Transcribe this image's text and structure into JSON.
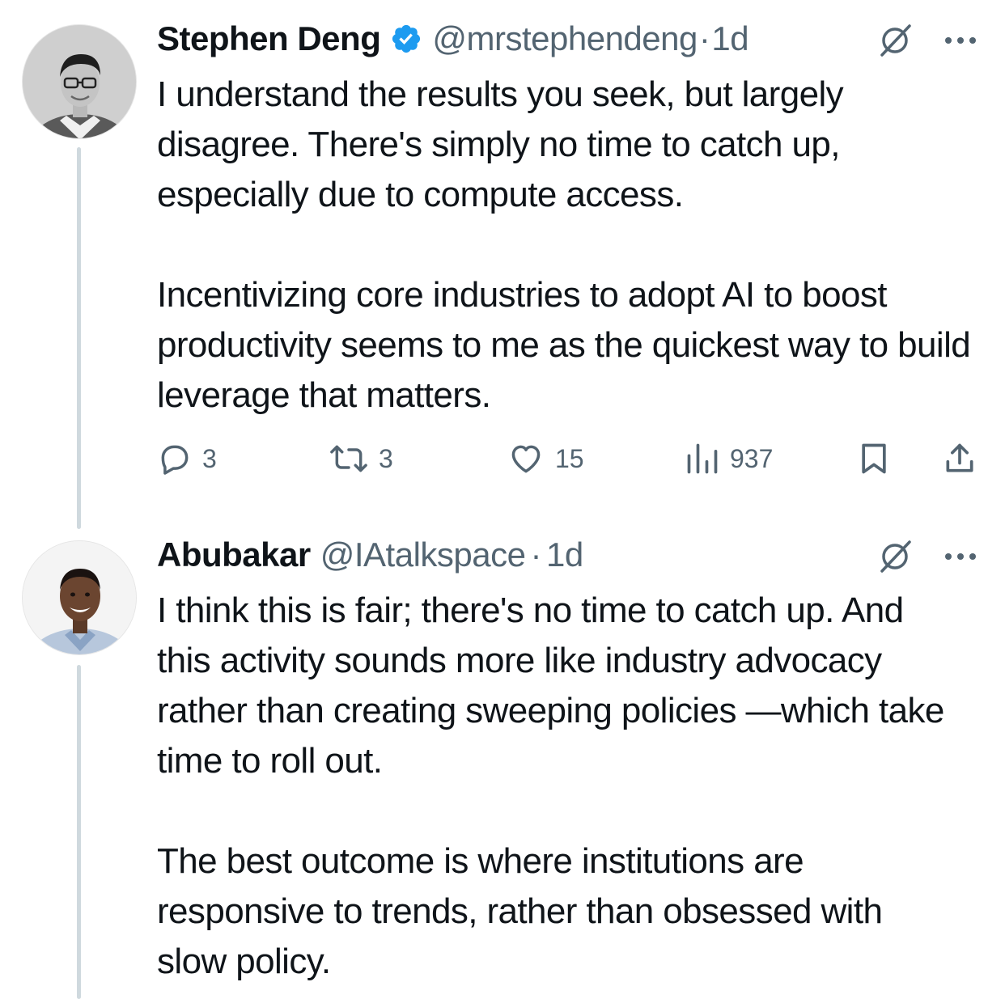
{
  "tweets": [
    {
      "name": "Stephen Deng",
      "verified": true,
      "handle": "@mrstephendeng",
      "separator": "·",
      "time": "1d",
      "paragraphs": [
        "I understand the results you seek, but largely disagree. There's simply no time to catch up, especially due to compute access.",
        "Incentivizing core industries to adopt AI to boost productivity seems to me as the quickest way to build leverage that matters."
      ],
      "stats": {
        "replies": "3",
        "reposts": "3",
        "likes": "15",
        "views": "937"
      }
    },
    {
      "name": "Abubakar",
      "verified": false,
      "handle": "@IAtalkspace",
      "separator": "·",
      "time": "1d",
      "paragraphs": [
        "I think this is fair; there's no time to catch up. And this activity sounds more like industry advocacy rather than creating sweeping policies —which take time to roll out.",
        "The best outcome is where institutions are responsive to trends, rather than obsessed with slow policy."
      ]
    }
  ],
  "colors": {
    "text": "#0f1419",
    "secondary": "#536471",
    "verified_blue": "#1d9bf0",
    "thread_line": "#cfd9de"
  },
  "icons": {
    "reply": "reply-icon",
    "repost": "repost-icon",
    "like": "heart-icon",
    "views": "views-icon",
    "bookmark": "bookmark-icon",
    "share": "share-icon",
    "grok": "grok-icon",
    "more": "more-icon"
  }
}
